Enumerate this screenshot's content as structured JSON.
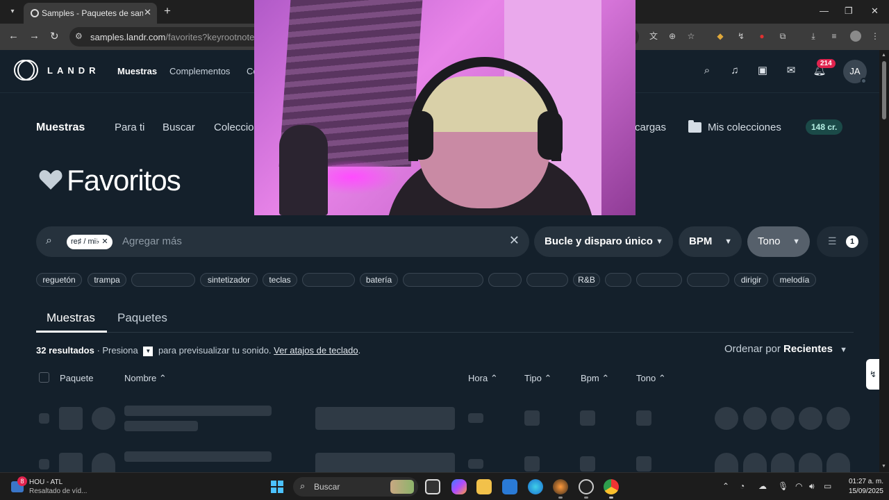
{
  "browser": {
    "tab_title": "Samples - Paquetes de samples",
    "url_main": "samples.landr.com",
    "url_path": "/favorites?keyrootnote=DS"
  },
  "header": {
    "logo_text": "LANDR",
    "nav": [
      "Muestras",
      "Complementos",
      "Co"
    ],
    "notifications_count": "214",
    "avatar_initials": "JA"
  },
  "subnav": {
    "brand": "Muestras",
    "items": [
      "Para ti",
      "Buscar",
      "Coleccio"
    ],
    "downloads_partial": "cargas",
    "collections": "Mis colecciones",
    "credits": "148 cr."
  },
  "page": {
    "title": "Favoritos"
  },
  "filters": {
    "chip_label": "re♯ / mi♭",
    "search_placeholder": "Agregar más",
    "loop_type": "Bucle y disparo único",
    "bpm": "BPM",
    "key": "Tono",
    "filter_count": "1"
  },
  "tags": [
    "reguetón",
    "trampa",
    "",
    "sintetizador",
    "teclas",
    "",
    "batería",
    "",
    "",
    "",
    "R&B",
    "",
    "",
    "",
    "dirigir",
    "melodía"
  ],
  "tabs": [
    "Muestras",
    "Paquetes"
  ],
  "results": {
    "count": "32 resultados",
    "press": "Presiona",
    "preview_text": "para previsualizar tu sonido.",
    "shortcuts_link": "Ver atajos de teclado",
    "period": ".",
    "sort_label": "Ordenar por",
    "sort_value": "Recientes"
  },
  "table_headers": {
    "pack": "Paquete",
    "name": "Nombre",
    "time": "Hora",
    "type": "Tipo",
    "bpm": "Bpm",
    "key": "Tono"
  },
  "taskbar": {
    "weather_badge": "8",
    "weather_line1": "HOU - ATL",
    "weather_line2": "Resaltado de víd...",
    "search_label": "Buscar",
    "time": "01:27 a. m.",
    "date": "15/09/2025"
  },
  "colors": {
    "page_bg": "#14202b",
    "credits_bg": "#1b4a48",
    "notification": "#e0234e"
  }
}
